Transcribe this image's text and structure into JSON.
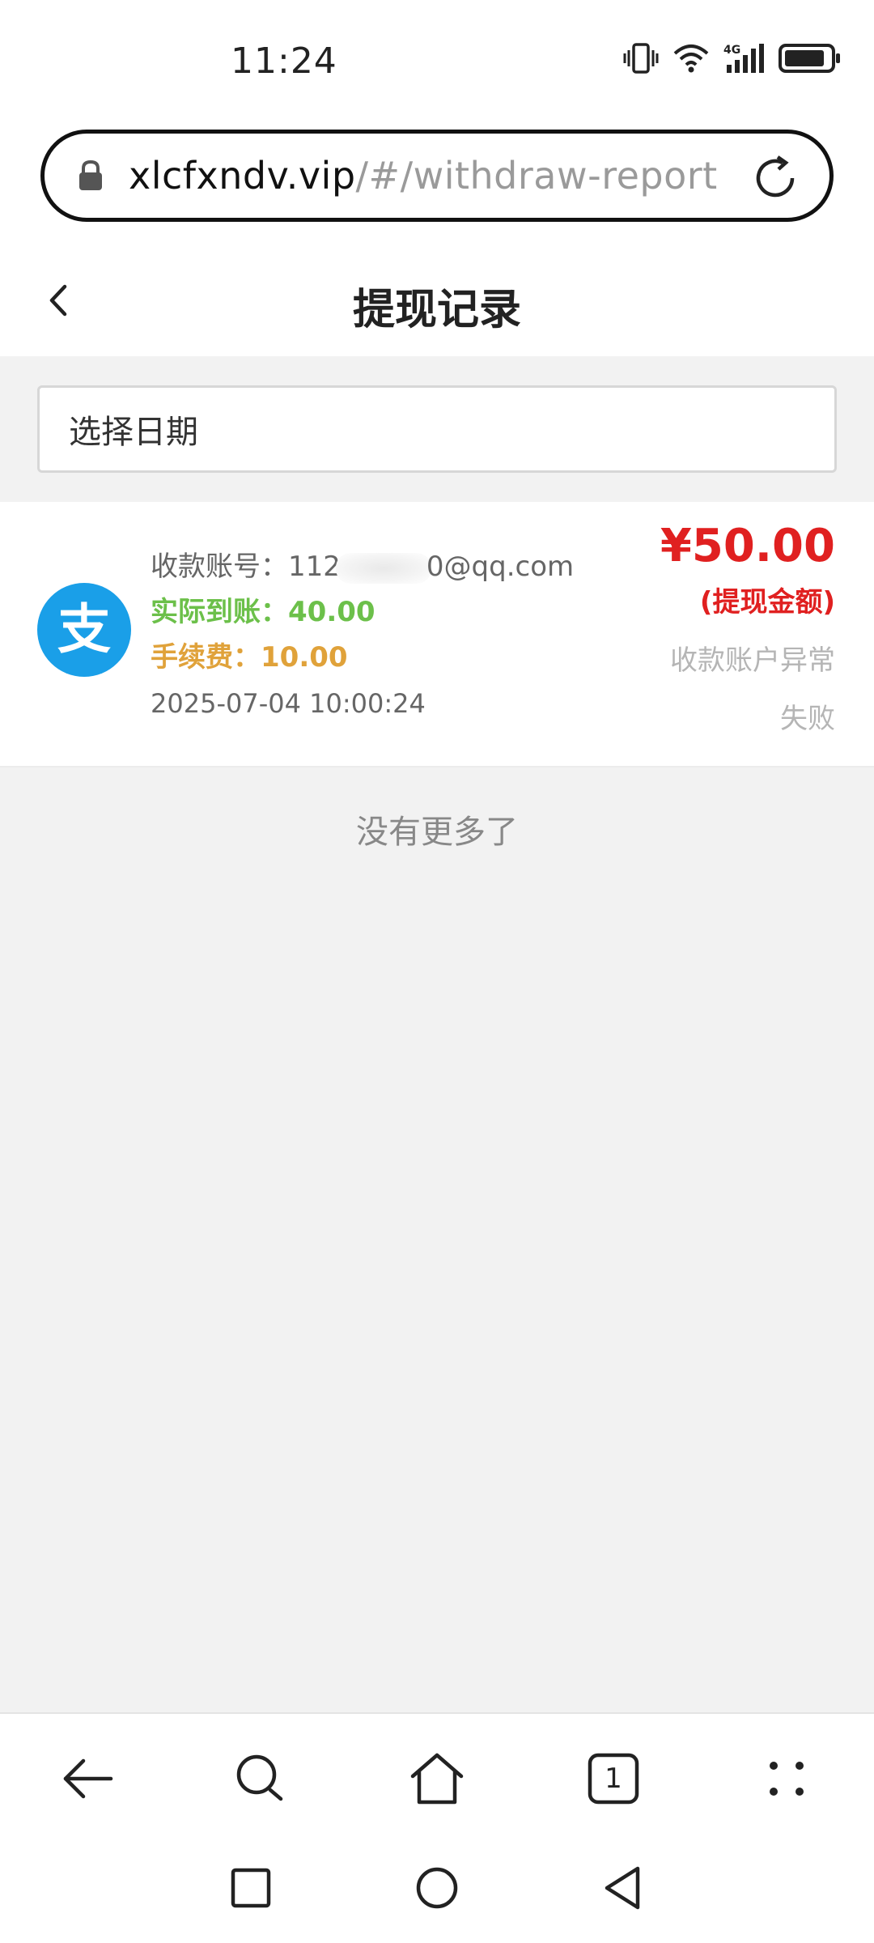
{
  "status_bar": {
    "time": "11:24",
    "network_label": "4G"
  },
  "browser": {
    "url_domain": "xlcfxndv.vip",
    "url_path": "/#/withdraw-report",
    "tab_count": "1"
  },
  "header": {
    "title": "提现记录"
  },
  "filter": {
    "date_placeholder": "选择日期"
  },
  "records": [
    {
      "account_label": "收款账号：",
      "account_prefix": "112",
      "account_suffix": "0@qq.com",
      "actual_label": "实际到账：",
      "actual_value": "40.00",
      "fee_label": "手续费：",
      "fee_value": "10.00",
      "time": "2025-07-04 10:00:24",
      "amount": "¥50.00",
      "amount_label": "(提现金额)",
      "reason": "收款账户异常",
      "status": "失败",
      "method_icon_char": "支"
    }
  ],
  "list_footer": {
    "no_more": "没有更多了"
  },
  "colors": {
    "amount": "#e02020",
    "actual": "#6cc04a",
    "fee": "#e0a23a",
    "alipay_blue": "#1a9fe8",
    "page_bg": "#f2f2f2"
  },
  "icons": {
    "status": [
      "vibrate-icon",
      "wifi-icon",
      "signal-icon",
      "battery-icon"
    ],
    "url_bar": [
      "lock-icon",
      "reload-icon"
    ],
    "toolbar": [
      "back-arrow-icon",
      "search-icon",
      "home-icon",
      "tabs-icon",
      "more-icon"
    ],
    "system_nav": [
      "recents-icon",
      "home-circle-icon",
      "back-triangle-icon"
    ]
  }
}
